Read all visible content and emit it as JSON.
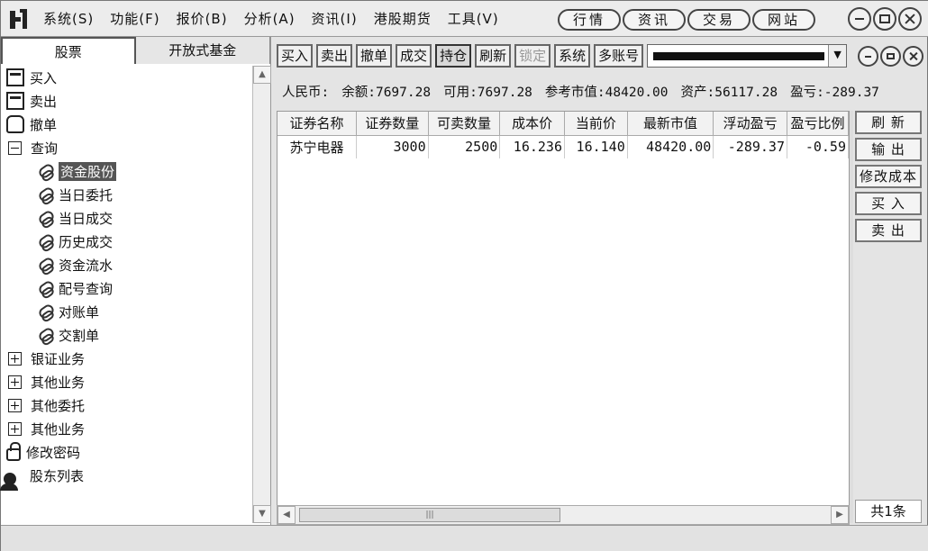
{
  "menu": {
    "items": [
      "系统(S)",
      "功能(F)",
      "报价(B)",
      "分析(A)",
      "资讯(I)",
      "港股期货",
      "工具(V)"
    ],
    "tabs": [
      "行情",
      "资讯",
      "交易",
      "网站"
    ]
  },
  "left_panel": {
    "tabs": [
      "股票",
      "开放式基金"
    ],
    "tree": [
      {
        "label": "买入",
        "icon": "buy-terminal-icon"
      },
      {
        "label": "卖出",
        "icon": "sell-terminal-icon"
      },
      {
        "label": "撤单",
        "icon": "hand-icon"
      },
      {
        "label": "查询",
        "icon": "collapse-minus-icon"
      },
      {
        "label": "资金股份",
        "icon": "leaf-icon",
        "selected": true
      },
      {
        "label": "当日委托",
        "icon": "leaf-icon"
      },
      {
        "label": "当日成交",
        "icon": "leaf-icon"
      },
      {
        "label": "历史成交",
        "icon": "leaf-icon"
      },
      {
        "label": "资金流水",
        "icon": "leaf-icon"
      },
      {
        "label": "配号查询",
        "icon": "leaf-icon"
      },
      {
        "label": "对账单",
        "icon": "leaf-icon"
      },
      {
        "label": "交割单",
        "icon": "leaf-icon"
      },
      {
        "label": "银证业务",
        "icon": "expand-plus-icon"
      },
      {
        "label": "其他业务",
        "icon": "expand-plus-icon"
      },
      {
        "label": "其他委托",
        "icon": "expand-plus-icon"
      },
      {
        "label": "其他业务",
        "icon": "expand-plus-icon"
      },
      {
        "label": "修改密码",
        "icon": "lock-icon"
      },
      {
        "label": "股东列表",
        "icon": "user-icon"
      }
    ]
  },
  "toolbar": {
    "buttons": [
      "买入",
      "卖出",
      "撤单",
      "成交",
      "持仓",
      "刷新",
      "锁定",
      "系统",
      "多账号"
    ],
    "active": "持仓",
    "disabled": "锁定"
  },
  "summary": {
    "currency": "人民币:",
    "balance": "余额:7697.28",
    "available": "可用:7697.28",
    "market_value": "参考市值:48420.00",
    "assets": "资产:56117.28",
    "profit": "盈亏:-289.37"
  },
  "grid": {
    "headers": [
      "证券名称",
      "证券数量",
      "可卖数量",
      "成本价",
      "当前价",
      "最新市值",
      "浮动盈亏",
      "盈亏比例"
    ],
    "rows": [
      [
        "苏宁电器",
        "3000",
        "2500",
        "16.236",
        "16.140",
        "48420.00",
        "-289.37",
        "-0.59"
      ]
    ]
  },
  "side_buttons": [
    "刷 新",
    "输 出",
    "修改成本",
    "买 入",
    "卖 出"
  ],
  "record_count": "共1条"
}
